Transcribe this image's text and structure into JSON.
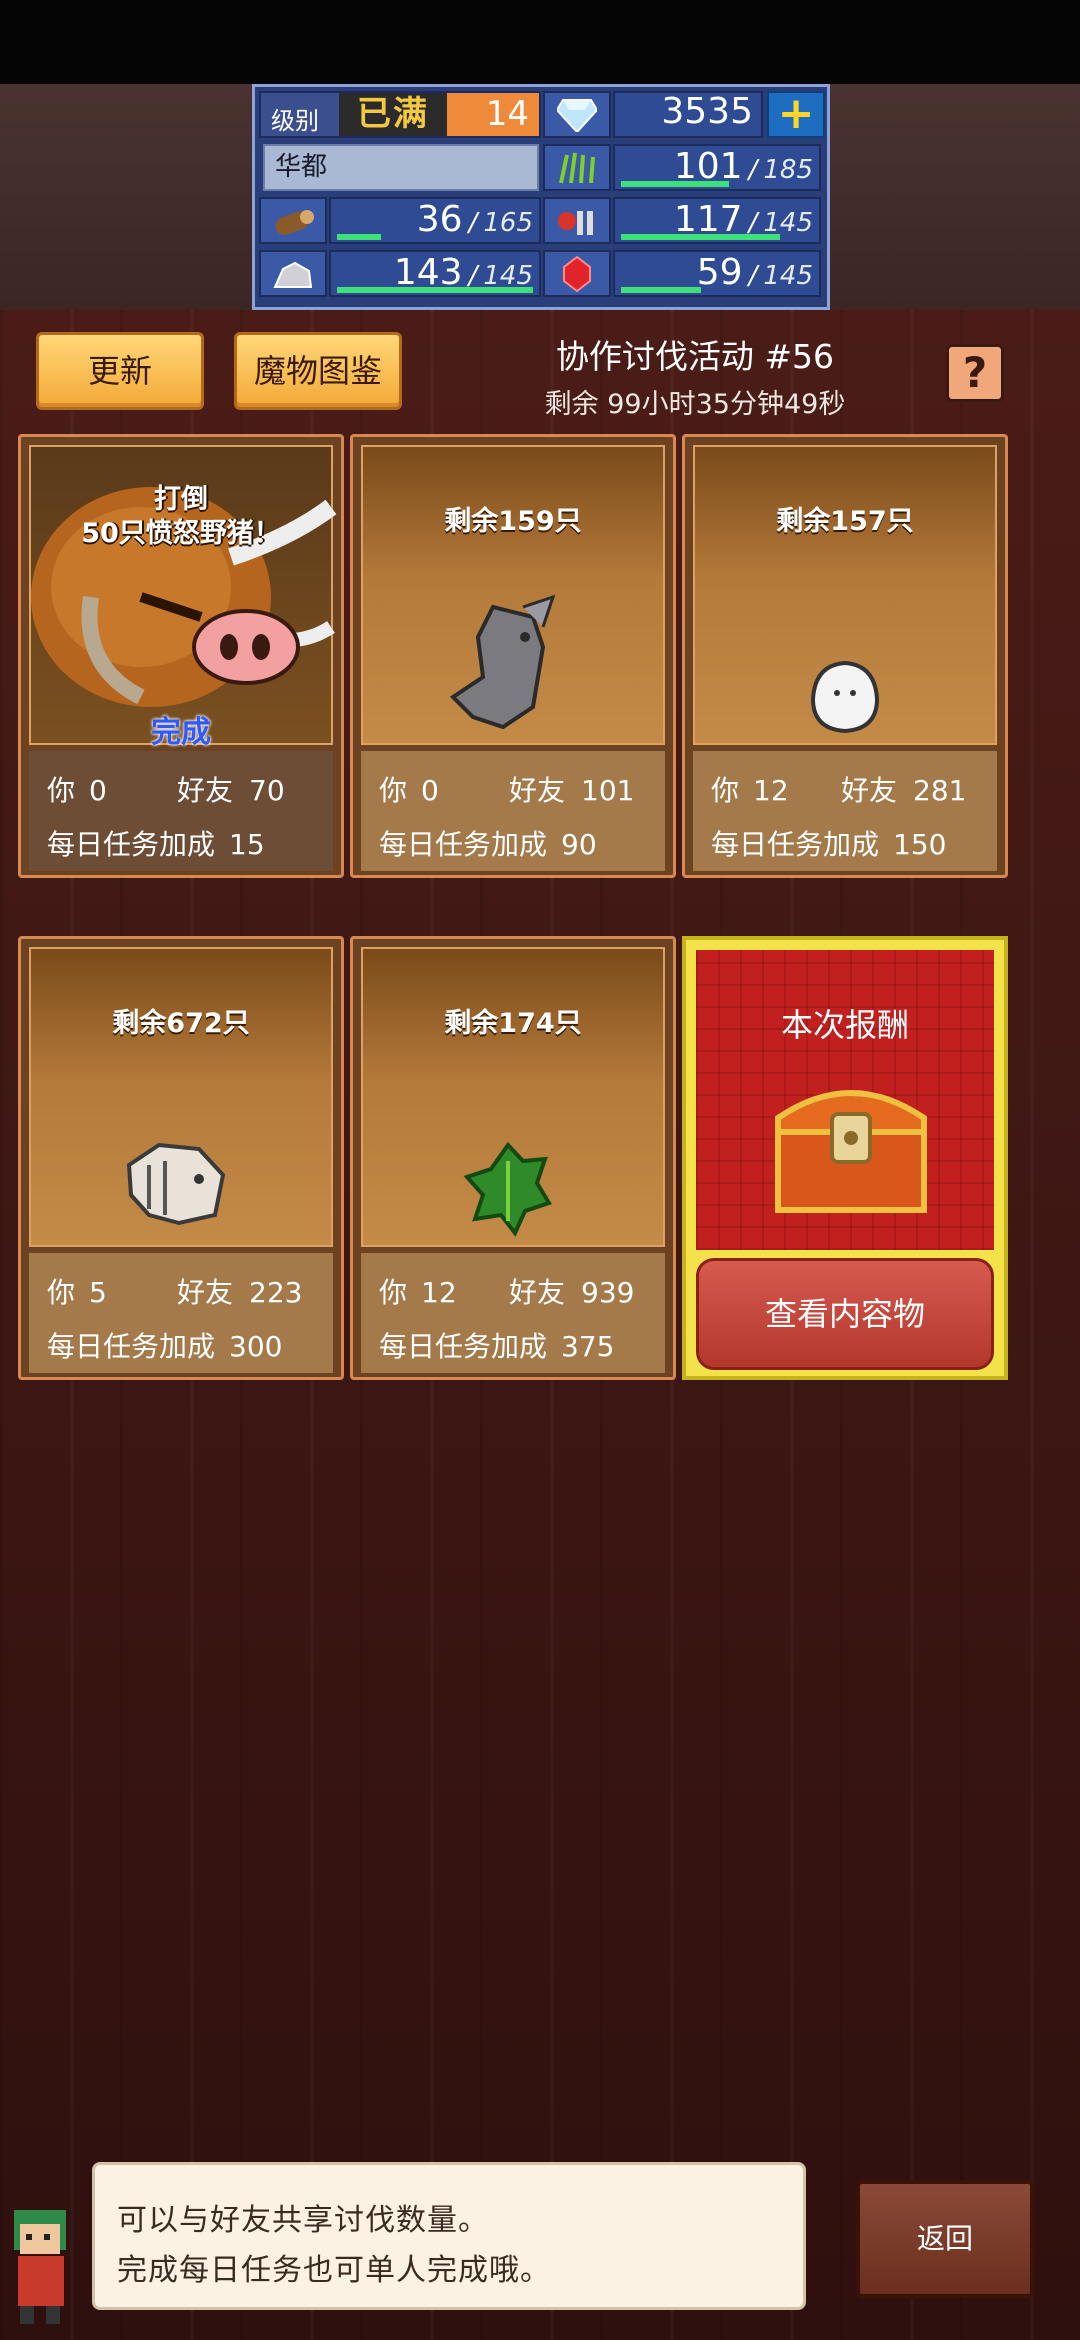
{
  "status": {
    "level_label": "级别",
    "level_max_text": "已满",
    "level_value": "14",
    "gems": "3535",
    "city_name": "华都",
    "resources": {
      "grass": {
        "value": "101",
        "max": "185",
        "fill": 0.55
      },
      "wood": {
        "value": "36",
        "max": "165",
        "fill": 0.22
      },
      "food": {
        "value": "117",
        "max": "145",
        "fill": 0.81
      },
      "ore": {
        "value": "143",
        "max": "145",
        "fill": 0.98
      },
      "ruby": {
        "value": "59",
        "max": "145",
        "fill": 0.41
      }
    },
    "plus_label": "+"
  },
  "toolbar": {
    "refresh_label": "更新",
    "bestiary_label": "魔物图鉴",
    "event_title": "协作讨伐活动 #56",
    "event_timer": "剩余 99小时35分钟49秒",
    "help_label": "?"
  },
  "labels": {
    "you": "你",
    "friends": "好友",
    "daily_bonus": "每日任务加成"
  },
  "cards": [
    {
      "title_line1": "打倒",
      "title_line2": "50只愤怒野猪！",
      "status": "完成",
      "you": "0",
      "friends": "70",
      "bonus": "15"
    },
    {
      "remain": "剩余159只",
      "monster": "gray-dragon",
      "you": "0",
      "friends": "101",
      "bonus": "90"
    },
    {
      "remain": "剩余157只",
      "monster": "white-ghost",
      "you": "12",
      "friends": "281",
      "bonus": "150"
    },
    {
      "remain": "剩余672只",
      "monster": "bone-beast",
      "you": "5",
      "friends": "223",
      "bonus": "300"
    },
    {
      "remain": "剩余174只",
      "monster": "green-plant",
      "you": "12",
      "friends": "939",
      "bonus": "375"
    }
  ],
  "reward": {
    "title": "本次报酬",
    "view_label": "查看内容物"
  },
  "tip": {
    "line1": "可以与好友共享讨伐数量。",
    "line2": "完成每日任务也可单人完成哦。"
  },
  "back_label": "返回"
}
